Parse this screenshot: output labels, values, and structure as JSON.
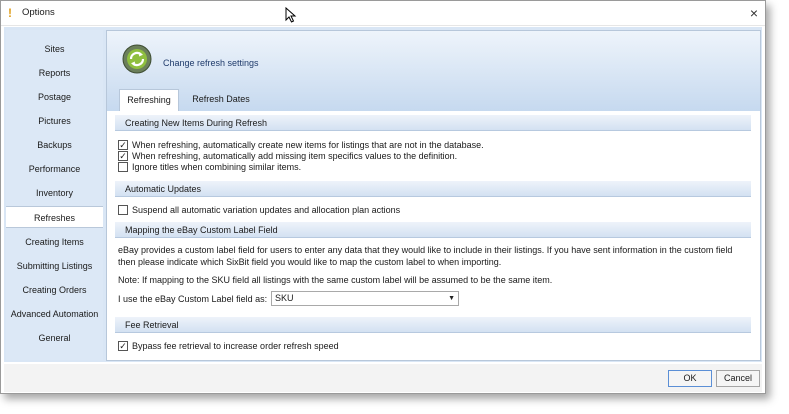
{
  "window": {
    "title": "Options",
    "close_label": "×"
  },
  "sidebar": {
    "items": [
      {
        "label": "Sites"
      },
      {
        "label": "Reports"
      },
      {
        "label": "Postage"
      },
      {
        "label": "Pictures"
      },
      {
        "label": "Backups"
      },
      {
        "label": "Performance"
      },
      {
        "label": "Inventory"
      },
      {
        "label": "Refreshes",
        "active": true
      },
      {
        "label": "Creating Items"
      },
      {
        "label": "Submitting Listings"
      },
      {
        "label": "Creating Orders"
      },
      {
        "label": "Advanced Automation"
      },
      {
        "label": "General"
      }
    ]
  },
  "header": {
    "title": "Change refresh settings",
    "icon": "refresh-settings-icon"
  },
  "tabs": [
    {
      "label": "Refreshing",
      "active": true
    },
    {
      "label": "Refresh Dates",
      "active": false
    }
  ],
  "sections": {
    "creating_new_items": {
      "title": "Creating New Items During Refresh",
      "options": [
        {
          "label": "When refreshing, automatically create new items for listings that are not in the database.",
          "checked": true
        },
        {
          "label": "When refreshing, automatically add missing item specifics values to the definition.",
          "checked": true
        },
        {
          "label": "Ignore titles when combining similar items.",
          "checked": false
        }
      ]
    },
    "automatic_updates": {
      "title": "Automatic Updates",
      "options": [
        {
          "label": "Suspend all automatic variation updates and allocation plan actions",
          "checked": false
        }
      ]
    },
    "custom_label": {
      "title": "Mapping the eBay Custom Label Field",
      "description_line1": "eBay provides a custom label field for users to enter any data that they would like to include in their listings.  If you have sent information in the custom field",
      "description_line2": "then please indicate which SixBit field you would like to map the custom label to when importing.",
      "note": "Note: If mapping to the SKU field all listings with the same custom label will be assumed to be the same item.",
      "field_label": "I use the eBay Custom Label field as:",
      "field_value": "SKU"
    },
    "fee_retrieval": {
      "title": "Fee Retrieval",
      "options": [
        {
          "label": "Bypass fee retrieval to increase order refresh speed",
          "checked": true
        }
      ]
    }
  },
  "buttons": {
    "ok": "OK",
    "cancel": "Cancel"
  },
  "check_glyph": "✓"
}
